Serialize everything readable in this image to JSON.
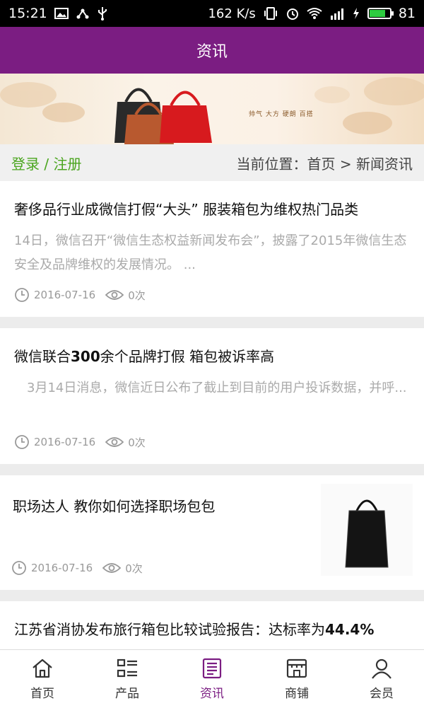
{
  "status_bar": {
    "time": "15:21",
    "speed": "162 K/s",
    "battery": "81",
    "battery_level": 0.81
  },
  "header": {
    "title": "资讯"
  },
  "banner": {
    "tagline": "帅气 大方 硬朗 百搭"
  },
  "breadcrumb": {
    "login_label": "登录 / 注册",
    "location_label": "当前位置：首页 > 新闻资讯"
  },
  "articles": [
    {
      "title": "奢侈品行业成微信打假“大头” 服装箱包为维权热门品类",
      "summary": "14日，微信召开“微信生态权益新闻发布会”，披露了2015年微信生态安全及品牌维权的发展情况。          ...",
      "date": "2016-07-16",
      "views": "0次"
    },
    {
      "title_pre": "微信联合",
      "title_bold": "300",
      "title_post": "余个品牌打假 箱包被诉率高",
      "summary": "　3月14日消息，微信近日公布了截止到目前的用户投诉数据，并呼...",
      "date": "2016-07-16",
      "views": "0次"
    },
    {
      "title": "职场达人 教你如何选择职场包包",
      "date": "2016-07-16",
      "views": "0次"
    },
    {
      "title_pre": "江苏省消协发布旅行箱包比较试验报告：达标率为",
      "title_bold": "44.4%"
    }
  ],
  "bottom_nav": [
    {
      "label": "首页",
      "icon": "home-icon"
    },
    {
      "label": "产品",
      "icon": "list-icon"
    },
    {
      "label": "资讯",
      "icon": "news-icon",
      "active": true
    },
    {
      "label": "商铺",
      "icon": "store-icon"
    },
    {
      "label": "会员",
      "icon": "user-icon"
    }
  ],
  "colors": {
    "brand": "#7b1d82",
    "login": "#4aa51e"
  }
}
